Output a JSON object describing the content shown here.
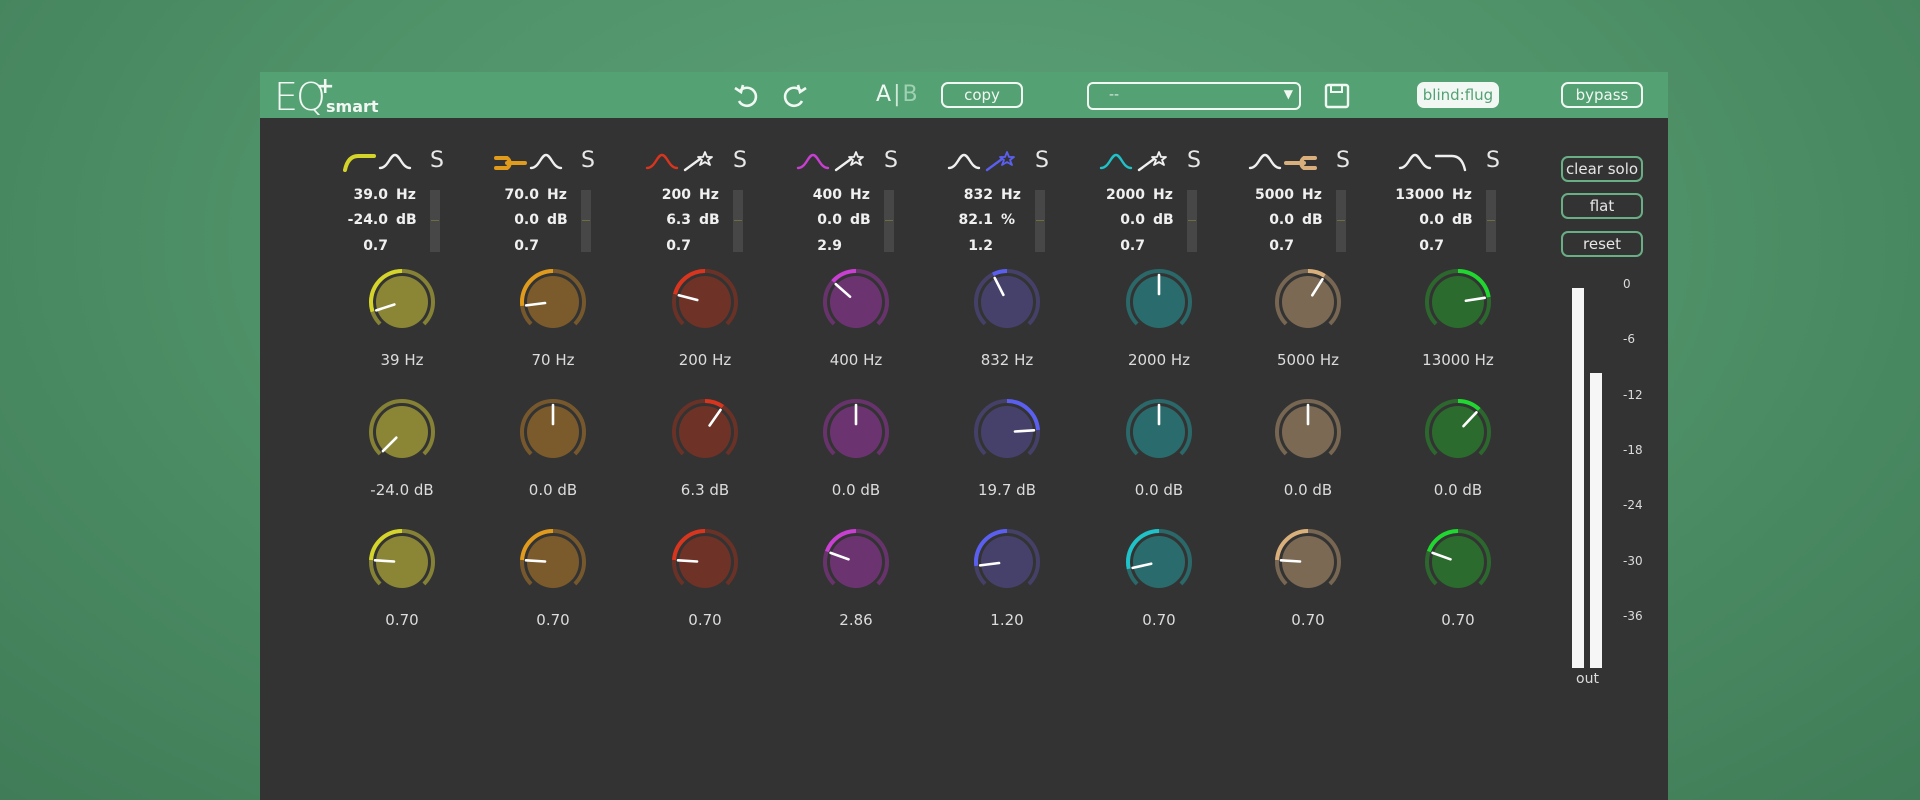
{
  "header": {
    "logo_main": "EQ",
    "logo_plus": "+",
    "logo_sub": "smart",
    "ab_a": "A",
    "ab_sep": "|",
    "ab_b": "B",
    "copy_label": "copy",
    "preset_value": "--",
    "blindflug_label": "blind:flug",
    "bypass_label": "bypass"
  },
  "solo_label": "S",
  "side": {
    "clear_solo": "clear solo",
    "flat": "flat",
    "reset": "reset",
    "meter_scale": [
      "0",
      "-6",
      "-12",
      "-18",
      "-24",
      "-30",
      "-36"
    ],
    "out_label": "out",
    "out_levels": [
      0.98,
      0.76
    ]
  },
  "bands": [
    {
      "color": "#d4d42a",
      "body": "#8a8636",
      "shape1": "lowcut",
      "shape2": "bell-white",
      "v1": "39.0",
      "u1": "Hz",
      "v2": "-24.0",
      "u2": "dB",
      "v3": "0.7",
      "u3": "",
      "knob_freq": {
        "label": "39 Hz",
        "value": 0.1
      },
      "knob_gain": {
        "label": "-24.0 dB",
        "value": 0.0
      },
      "knob_q": {
        "label": "0.70",
        "value": 0.18
      }
    },
    {
      "color": "#e09a1c",
      "body": "#7b5b2c",
      "shape1": "lowshelf",
      "shape2": "bell-white",
      "v1": "70.0",
      "u1": "Hz",
      "v2": "0.0",
      "u2": "dB",
      "v3": "0.7",
      "u3": "",
      "knob_freq": {
        "label": "70 Hz",
        "value": 0.14
      },
      "knob_gain": {
        "label": "0.0 dB",
        "value": 0.5
      },
      "knob_q": {
        "label": "0.70",
        "value": 0.18
      }
    },
    {
      "color": "#d8351e",
      "body": "#6e3227",
      "shape1": "bell",
      "shape2": "wand-white",
      "v1": "200",
      "u1": "Hz",
      "v2": "6.3",
      "u2": "dB",
      "v3": "0.7",
      "u3": "",
      "knob_freq": {
        "label": "200 Hz",
        "value": 0.22
      },
      "knob_gain": {
        "label": "6.3 dB",
        "value": 0.63
      },
      "knob_q": {
        "label": "0.70",
        "value": 0.18
      }
    },
    {
      "color": "#c83fd2",
      "body": "#6b3470",
      "shape1": "bell",
      "shape2": "wand-white",
      "v1": "400",
      "u1": "Hz",
      "v2": "0.0",
      "u2": "dB",
      "v3": "2.9",
      "u3": "",
      "knob_freq": {
        "label": "400 Hz",
        "value": 0.32
      },
      "knob_gain": {
        "label": "0.0 dB",
        "value": 0.5
      },
      "knob_q": {
        "label": "2.86",
        "value": 0.24
      }
    },
    {
      "color": "#5b5ff0",
      "body": "#46416b",
      "shape1": "bell-white",
      "shape2": "wand-color",
      "v1": "832",
      "u1": "Hz",
      "v2": "82.1",
      "u2": "%",
      "v3": "1.2",
      "u3": "",
      "knob_freq": {
        "label": "832 Hz",
        "value": 0.4
      },
      "knob_gain": {
        "label": "19.7 dB",
        "value": 0.82
      },
      "knob_q": {
        "label": "1.20",
        "value": 0.14
      }
    },
    {
      "color": "#1ec2c8",
      "body": "#2a6c6d",
      "shape1": "bell",
      "shape2": "wand-white",
      "v1": "2000",
      "u1": "Hz",
      "v2": "0.0",
      "u2": "dB",
      "v3": "0.7",
      "u3": "",
      "knob_freq": {
        "label": "2000 Hz",
        "value": 0.5
      },
      "knob_gain": {
        "label": "0.0 dB",
        "value": 0.5
      },
      "knob_q": {
        "label": "0.70",
        "value": 0.12
      }
    },
    {
      "color": "#d9b07b",
      "body": "#7b6954",
      "shape1": "bell-white",
      "shape2": "highshelf",
      "v1": "5000",
      "u1": "Hz",
      "v2": "0.0",
      "u2": "dB",
      "v3": "0.7",
      "u3": "",
      "knob_freq": {
        "label": "5000 Hz",
        "value": 0.62
      },
      "knob_gain": {
        "label": "0.0 dB",
        "value": 0.5
      },
      "knob_q": {
        "label": "0.70",
        "value": 0.18
      }
    },
    {
      "color": "#20d630",
      "body": "#2c6b2e",
      "shape1": "bell-white",
      "shape2": "highcut-white",
      "v1": "13000",
      "u1": "Hz",
      "v2": "0.0",
      "u2": "dB",
      "v3": "0.7",
      "u3": "",
      "knob_freq": {
        "label": "13000 Hz",
        "value": 0.8
      },
      "knob_gain": {
        "label": "0.0 dB",
        "value": 0.66
      },
      "knob_q": {
        "label": "0.70",
        "value": 0.24
      }
    }
  ]
}
